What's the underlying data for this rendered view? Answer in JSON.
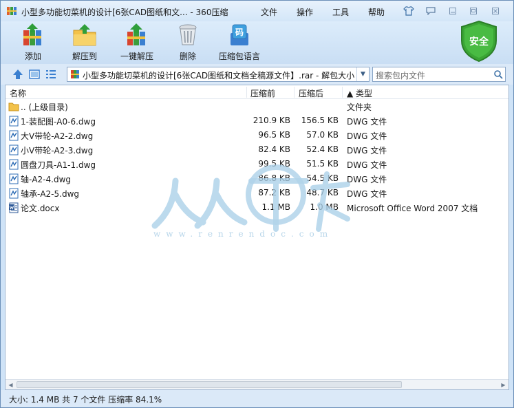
{
  "title": {
    "text": "小型多功能切菜机的设计[6张CAD图纸和文... - 360压缩",
    "menus": [
      "文件",
      "操作",
      "工具",
      "帮助"
    ]
  },
  "toolbar": {
    "buttons": [
      {
        "label": "添加",
        "icon": "add-books-icon"
      },
      {
        "label": "解压到",
        "icon": "extract-folder-icon"
      },
      {
        "label": "一键解压",
        "icon": "one-click-extract-icon"
      },
      {
        "label": "删除",
        "icon": "trash-icon"
      },
      {
        "label": "压缩包语言",
        "icon": "archive-language-icon",
        "badge": "码"
      }
    ],
    "security_badge": "安全"
  },
  "navbar": {
    "path": "小型多功能切菜机的设计[6张CAD图纸和文档全稿源文件】.rar - 解包大小",
    "search_placeholder": "搜索包内文件"
  },
  "list": {
    "columns": {
      "name": "名称",
      "compressed_before": "压缩前",
      "compressed_after": "压缩后",
      "type": "▲ 类型"
    },
    "rows": [
      {
        "name": ".. (上级目录)",
        "before": "",
        "after": "",
        "type": "文件夹",
        "icon": "folder-icon"
      },
      {
        "name": "1-装配图-A0-6.dwg",
        "before": "210.9 KB",
        "after": "156.5 KB",
        "type": "DWG 文件",
        "icon": "dwg-file-icon"
      },
      {
        "name": "大V带轮-A2-2.dwg",
        "before": "96.5 KB",
        "after": "57.0 KB",
        "type": "DWG 文件",
        "icon": "dwg-file-icon"
      },
      {
        "name": "小V带轮-A2-3.dwg",
        "before": "82.4 KB",
        "after": "52.4 KB",
        "type": "DWG 文件",
        "icon": "dwg-file-icon"
      },
      {
        "name": "圆盘刀具-A1-1.dwg",
        "before": "99.5 KB",
        "after": "51.5 KB",
        "type": "DWG 文件",
        "icon": "dwg-file-icon"
      },
      {
        "name": "轴-A2-4.dwg",
        "before": "86.8 KB",
        "after": "54.5 KB",
        "type": "DWG 文件",
        "icon": "dwg-file-icon"
      },
      {
        "name": "轴承-A2-5.dwg",
        "before": "87.2 KB",
        "after": "48.7 KB",
        "type": "DWG 文件",
        "icon": "dwg-file-icon"
      },
      {
        "name": "论文.docx",
        "before": "1.1 MB",
        "after": "1.0 MB",
        "type": "Microsoft Office Word 2007 文档",
        "icon": "word-doc-icon"
      }
    ]
  },
  "watermark": {
    "url": "www.renrendoc.com"
  },
  "status": {
    "text": "大小: 1.4 MB 共 7 个文件 压缩率 84.1%"
  },
  "colors": {
    "accent": "#3a7fd0",
    "shield_green": "#3aa535",
    "window_bg": "#cfe3f7"
  }
}
